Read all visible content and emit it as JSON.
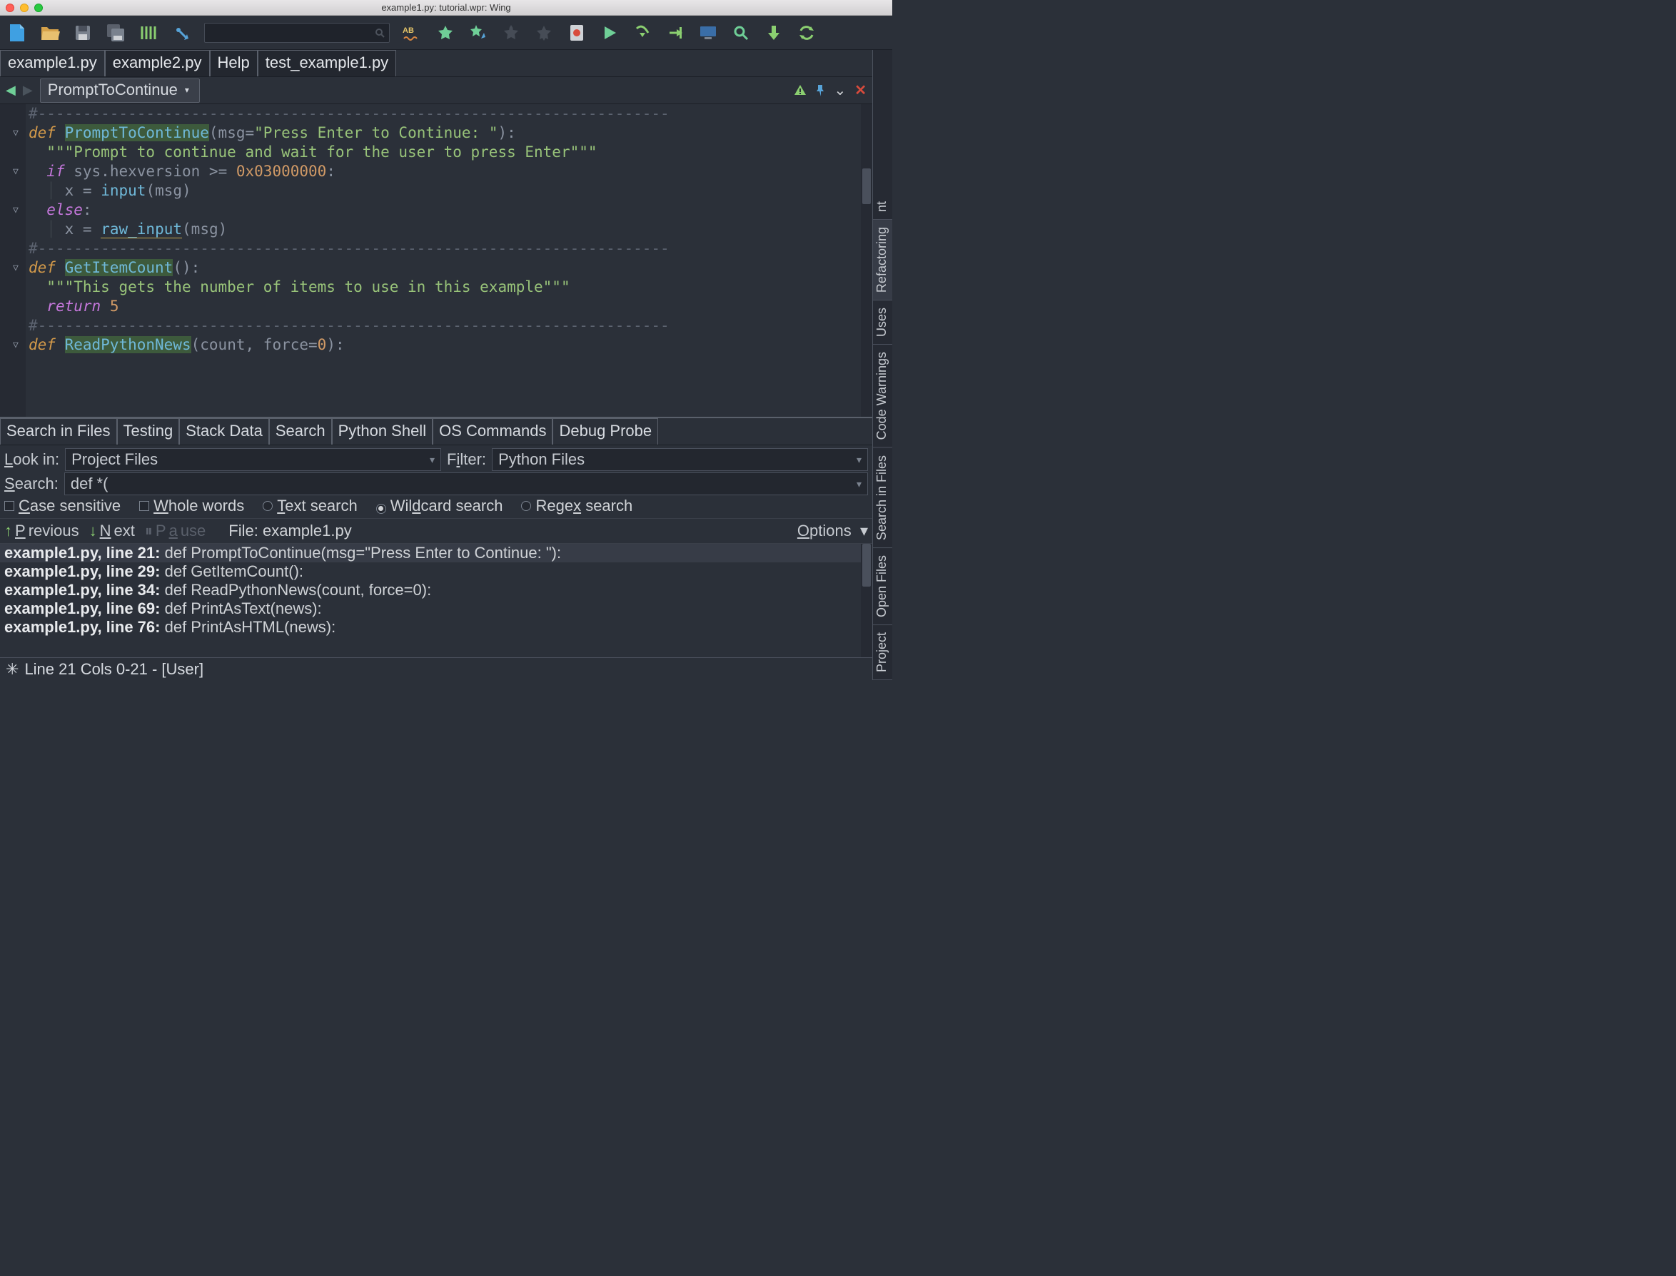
{
  "window": {
    "title": "example1.py: tutorial.wpr: Wing"
  },
  "filetabs": [
    "example1.py",
    "example2.py",
    "Help",
    "test_example1.py"
  ],
  "navbar": {
    "symbol": "PromptToContinue"
  },
  "code": {
    "lines": [
      {
        "html": "<span class='comment'>#----------------------------------------------------------------------</span>"
      },
      {
        "fold": true,
        "html": "<span class='kw-def'>def</span> <span class='fn-name hl'>PromptToContinue</span><span class='op'>(</span><span class='ident'>msg</span><span class='op'>=</span><span class='str'>\"Press Enter to Continue: \"</span><span class='op'>):</span>"
      },
      {
        "html": "  <span class='str'>\"\"\"Prompt to continue and wait for the user to press Enter\"\"\"</span>"
      },
      {
        "fold": true,
        "html": "  <span class='kw-if'>if</span> <span class='ident'>sys.hexversion</span> <span class='op'>&gt;=</span> <span class='num'>0x03000000</span><span class='op'>:</span>"
      },
      {
        "html": "  <span class='guide'>│ </span><span class='ident'>x</span> <span class='op'>=</span> <span class='fn-name'>input</span><span class='op'>(</span><span class='ident'>msg</span><span class='op'>)</span>"
      },
      {
        "fold": true,
        "html": "  <span class='kw-else'>else</span><span class='op'>:</span>"
      },
      {
        "html": "  <span class='guide'>│ </span><span class='ident'>x</span> <span class='op'>=</span> <span class='fn-name under'>raw_input</span><span class='op'>(</span><span class='ident'>msg</span><span class='op'>)</span>"
      },
      {
        "html": ""
      },
      {
        "html": "<span class='comment'>#----------------------------------------------------------------------</span>"
      },
      {
        "fold": true,
        "html": "<span class='kw-def'>def</span> <span class='fn-name hl'>GetItemCount</span><span class='op'>():</span>"
      },
      {
        "html": "  <span class='str'>\"\"\"This gets the number of items to use in this example\"\"\"</span>"
      },
      {
        "html": "  <span class='kw-ret'>return</span> <span class='num'>5</span>"
      },
      {
        "html": ""
      },
      {
        "html": "<span class='comment'>#----------------------------------------------------------------------</span>"
      },
      {
        "fold": true,
        "html": "<span class='kw-def'>def</span> <span class='fn-name hl'>ReadPythonNews</span><span class='op'>(</span><span class='ident'>count</span><span class='op'>,</span> <span class='ident'>force</span><span class='op'>=</span><span class='num'>0</span><span class='op'>):</span>"
      }
    ]
  },
  "bottom_tabs": [
    "Search in Files",
    "Testing",
    "Stack Data",
    "Search",
    "Python Shell",
    "OS Commands",
    "Debug Probe"
  ],
  "search": {
    "look_in_label": "Look in:",
    "look_in": "Project Files",
    "filter_label": "Filter:",
    "filter": "Python Files",
    "search_label": "Search:",
    "query": "def *(",
    "case_label": "Case sensitive",
    "whole_label": "Whole words",
    "text_label": "Text search",
    "wild_label": "Wildcard search",
    "regex_label": "Regex search",
    "prev": "Previous",
    "next": "Next",
    "pause": "Pause",
    "file_label": "File: example1.py",
    "options": "Options"
  },
  "results": [
    {
      "loc": "example1.py, line 21:",
      "txt": " def PromptToContinue(msg=\"Press Enter to Continue: \"):"
    },
    {
      "loc": "example1.py, line 29:",
      "txt": " def GetItemCount():"
    },
    {
      "loc": "example1.py, line 34:",
      "txt": " def ReadPythonNews(count, force=0):"
    },
    {
      "loc": "example1.py, line 69:",
      "txt": " def PrintAsText(news):"
    },
    {
      "loc": "example1.py, line 76:",
      "txt": " def PrintAsHTML(news):"
    }
  ],
  "statusbar": "Line 21 Cols 0-21 - [User]",
  "side_tabs": [
    "Project",
    "Open Files",
    "Search in Files",
    "Code Warnings",
    "Uses",
    "Refactoring",
    "nt"
  ]
}
